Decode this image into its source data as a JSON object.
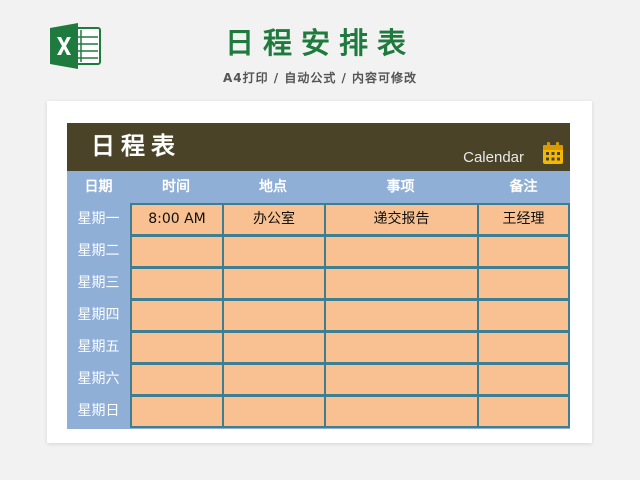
{
  "header": {
    "title": "日程安排表",
    "subtitle": "A4打印 / 自动公式 / 内容可修改"
  },
  "sheet": {
    "title": "日程表",
    "calendar_label": "Calendar",
    "icons": {
      "logo": "excel-logo-icon",
      "calendar": "calendar-icon"
    },
    "colors": {
      "title_green": "#1f7a3e",
      "header_bar": "#4a4327",
      "table_blue": "#8fafd6",
      "cell_fill": "#f9c191",
      "cell_border": "#3d7e93",
      "calendar_icon": "#f5b800"
    },
    "columns": [
      "日期",
      "时间",
      "地点",
      "事项",
      "备注"
    ],
    "rows": [
      {
        "day": "星期一",
        "cells": [
          "8:00 AM",
          "办公室",
          "递交报告",
          "王经理"
        ]
      },
      {
        "day": "星期二",
        "cells": [
          "",
          "",
          "",
          ""
        ]
      },
      {
        "day": "星期三",
        "cells": [
          "",
          "",
          "",
          ""
        ]
      },
      {
        "day": "星期四",
        "cells": [
          "",
          "",
          "",
          ""
        ]
      },
      {
        "day": "星期五",
        "cells": [
          "",
          "",
          "",
          ""
        ]
      },
      {
        "day": "星期六",
        "cells": [
          "",
          "",
          "",
          ""
        ]
      },
      {
        "day": "星期日",
        "cells": [
          "",
          "",
          "",
          ""
        ]
      }
    ]
  }
}
